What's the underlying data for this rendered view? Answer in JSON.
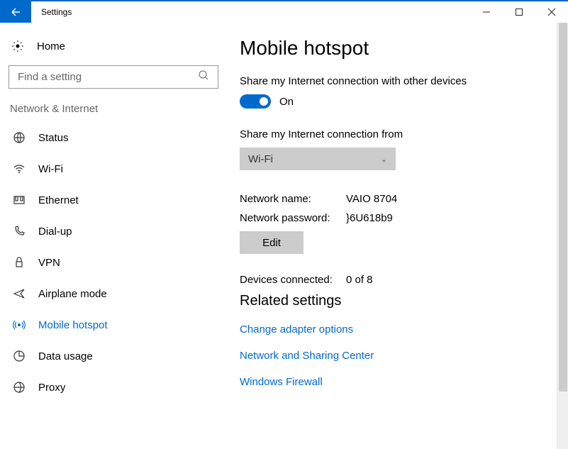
{
  "window": {
    "title": "Settings"
  },
  "sidebar": {
    "home": "Home",
    "search_placeholder": "Find a setting",
    "section": "Network & Internet",
    "items": [
      {
        "label": "Status"
      },
      {
        "label": "Wi-Fi"
      },
      {
        "label": "Ethernet"
      },
      {
        "label": "Dial-up"
      },
      {
        "label": "VPN"
      },
      {
        "label": "Airplane mode"
      },
      {
        "label": "Mobile hotspot"
      },
      {
        "label": "Data usage"
      },
      {
        "label": "Proxy"
      }
    ]
  },
  "main": {
    "title": "Mobile hotspot",
    "share_label": "Share my Internet connection with other devices",
    "toggle_state": "On",
    "share_from_label": "Share my Internet connection from",
    "share_from_value": "Wi-Fi",
    "network_name_label": "Network name:",
    "network_name_value": "VAIO 8704",
    "network_password_label": "Network password:",
    "network_password_value": "}6U618b9",
    "edit_label": "Edit",
    "devices_label": "Devices connected:",
    "devices_value": "0 of 8",
    "related_title": "Related settings",
    "links": {
      "adapter": "Change adapter options",
      "sharing": "Network and Sharing Center",
      "firewall": "Windows Firewall"
    }
  }
}
